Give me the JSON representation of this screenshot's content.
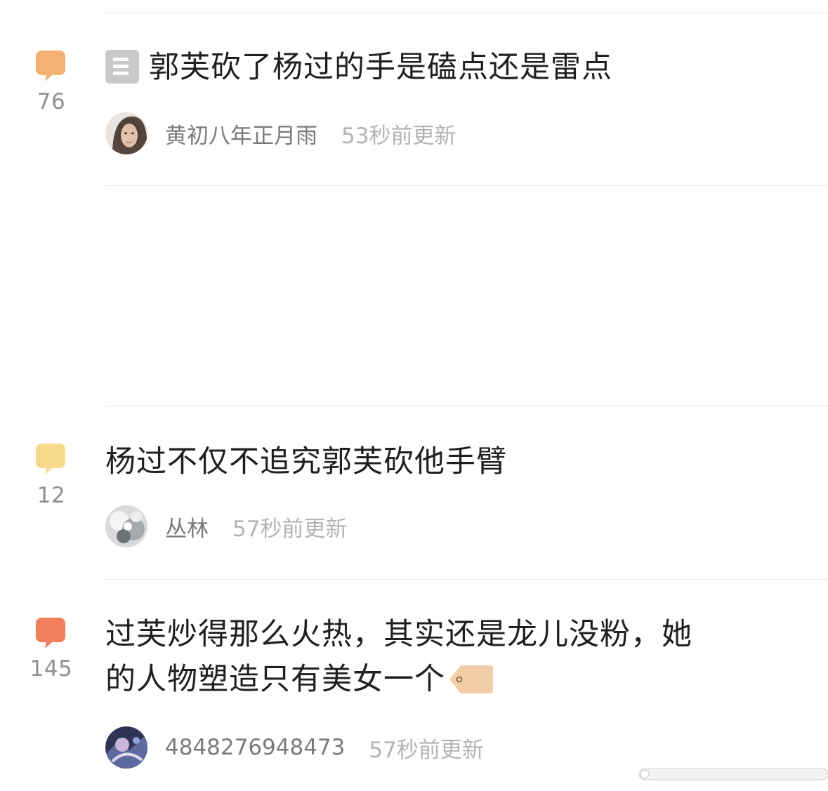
{
  "posts": [
    {
      "reply_count": "76",
      "bubble_color": "#f5b073",
      "has_doc_icon": true,
      "title": "郭芙砍了杨过的手是磕点还是雷点",
      "author": "黄初八年正月雨",
      "time": "53秒前更新",
      "avatar_icon": "user-avatar-woman-portrait"
    },
    {
      "reply_count": "12",
      "bubble_color": "#f9d98c",
      "has_doc_icon": false,
      "title": "杨过不仅不追究郭芙砍他手臂",
      "author": "丛林",
      "time": "57秒前更新",
      "avatar_icon": "user-avatar-silver-abstract"
    },
    {
      "reply_count": "145",
      "bubble_color": "#f27e5d",
      "has_doc_icon": false,
      "title_line1": "过芙炒得那么火热，其实还是龙儿没粉，她",
      "title_line2": "的人物塑造只有美女一个",
      "has_tag_icon": true,
      "author": "4848276948473",
      "time": "57秒前更新",
      "avatar_icon": "user-avatar-blue-anime"
    }
  ],
  "colors": {
    "title_text": "#202020",
    "author_text": "#7a7a7a",
    "time_text": "#b4b4b4",
    "count_text": "#8f8f8f",
    "divider": "#e8e8e8",
    "tag_color": "#f3cda5"
  }
}
